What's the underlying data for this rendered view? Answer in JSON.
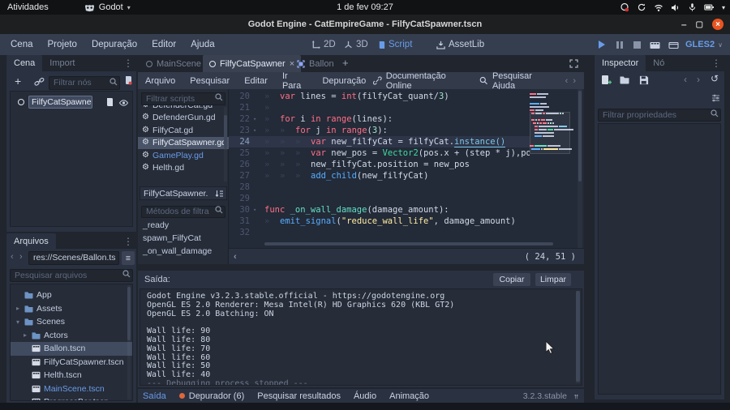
{
  "colors": {
    "accent": "#699ce8",
    "close_button": "#e95420",
    "keyword": "#ff7085",
    "type": "#3fdc9e",
    "function": "#57aeff",
    "string": "#ffeda1",
    "number": "#9fe8c8"
  },
  "desktop_bar": {
    "activities": "Atividades",
    "app_name": "Godot",
    "clock": "1 de fev 09:27"
  },
  "window": {
    "title": "Godot Engine - CatEmpireGame - FilfyCatSpawner.tscn"
  },
  "main_menu": {
    "items": [
      "Cena",
      "Projeto",
      "Depuração",
      "Editor",
      "Ajuda"
    ],
    "workspace_2d": "2D",
    "workspace_3d": "3D",
    "workspace_script": "Script",
    "workspace_assetlib": "AssetLib",
    "renderer": "GLES2"
  },
  "scene_dock": {
    "tab_scene": "Cena",
    "tab_import": "Import",
    "filter_placeholder": "Filtrar nós",
    "root_node": "FilfyCatSpawner"
  },
  "files_dock": {
    "title": "Arquivos",
    "path": "res://Scenes/Ballon.ts",
    "search_placeholder": "Pesquisar arquivos",
    "tree": [
      {
        "name": "App",
        "type": "folder",
        "depth": 1,
        "arrow": ""
      },
      {
        "name": "Assets",
        "type": "folder",
        "depth": 1,
        "arrow": "closed"
      },
      {
        "name": "Scenes",
        "type": "folder",
        "depth": 1,
        "arrow": "open"
      },
      {
        "name": "Actors",
        "type": "folder",
        "depth": 2,
        "arrow": "closed"
      },
      {
        "name": "Ballon.tscn",
        "type": "scene",
        "depth": 2,
        "selected": true
      },
      {
        "name": "FilfyCatSpawner.tscn",
        "type": "scene",
        "depth": 2
      },
      {
        "name": "Helth.tscn",
        "type": "scene",
        "depth": 2
      },
      {
        "name": "MainScene.tscn",
        "type": "scene",
        "depth": 2,
        "highlight": true
      },
      {
        "name": "ProgressBar.tscn",
        "type": "scene",
        "depth": 2
      }
    ]
  },
  "scene_tabs": {
    "tabs": [
      {
        "label": "MainScene",
        "active": false
      },
      {
        "label": "FilfyCatSpawner",
        "active": true,
        "closable": true
      },
      {
        "label": "Ballon",
        "active": false
      }
    ]
  },
  "script_editor": {
    "menus": [
      "Arquivo",
      "Pesquisar",
      "Editar",
      "Ir Para",
      "Depuração"
    ],
    "online_docs": "Documentação Online",
    "search_help": "Pesquisar Ajuda",
    "filter_scripts_placeholder": "Filtrar scripts",
    "scripts": [
      {
        "name": "DefenderCat.gd"
      },
      {
        "name": "DefenderGun.gd"
      },
      {
        "name": "FilfyCat.gd"
      },
      {
        "name": "FilfyCatSpawner.gd",
        "selected": true
      },
      {
        "name": "GamePlay.gd",
        "highlight": true
      },
      {
        "name": "Helth.gd"
      }
    ],
    "current_script": "FilfyCatSpawner.",
    "methods_filter_placeholder": "Métodos de filtra",
    "methods": [
      "_ready",
      "spawn_FilfyCat",
      "_on_wall_damage"
    ],
    "cursor_position": "( 24, 51 )",
    "code_lines": [
      {
        "n": 20,
        "indent": 1,
        "tokens": [
          {
            "t": "var ",
            "c": "kw"
          },
          {
            "t": "lines = ",
            "c": "tx"
          },
          {
            "t": "int",
            "c": "kw"
          },
          {
            "t": "(filfyCat_quant/",
            "c": "tx"
          },
          {
            "t": "3",
            "c": "num"
          },
          {
            "t": ")",
            "c": "tx"
          }
        ]
      },
      {
        "n": 21,
        "indent": 1,
        "tokens": []
      },
      {
        "n": 22,
        "indent": 1,
        "fold": true,
        "tokens": [
          {
            "t": "for ",
            "c": "kw"
          },
          {
            "t": "i ",
            "c": "tx"
          },
          {
            "t": "in ",
            "c": "kw"
          },
          {
            "t": "range",
            "c": "kw"
          },
          {
            "t": "(lines):",
            "c": "tx"
          }
        ]
      },
      {
        "n": 23,
        "indent": 2,
        "fold": true,
        "tokens": [
          {
            "t": "for ",
            "c": "kw"
          },
          {
            "t": "j ",
            "c": "tx"
          },
          {
            "t": "in ",
            "c": "kw"
          },
          {
            "t": "range",
            "c": "kw"
          },
          {
            "t": "(",
            "c": "tx"
          },
          {
            "t": "3",
            "c": "num"
          },
          {
            "t": "):",
            "c": "tx"
          }
        ]
      },
      {
        "n": 24,
        "indent": 3,
        "current": true,
        "tokens": [
          {
            "t": "var ",
            "c": "kw"
          },
          {
            "t": "new_filfyCat = filfyCat.",
            "c": "tx"
          },
          {
            "t": "instance()",
            "c": "mfn"
          }
        ]
      },
      {
        "n": 25,
        "indent": 3,
        "tokens": [
          {
            "t": "var ",
            "c": "kw"
          },
          {
            "t": "new_pos = ",
            "c": "tx"
          },
          {
            "t": "Vector2",
            "c": "ty"
          },
          {
            "t": "(pos.x + (step * j),pos.y + (i",
            "c": "tx"
          }
        ]
      },
      {
        "n": 26,
        "indent": 3,
        "tokens": [
          {
            "t": "new_filfyCat.position = new_pos",
            "c": "tx"
          }
        ]
      },
      {
        "n": 27,
        "indent": 3,
        "tokens": [
          {
            "t": "add_child",
            "c": "fn"
          },
          {
            "t": "(new_filfyCat)",
            "c": "tx"
          }
        ]
      },
      {
        "n": 28,
        "indent": 0,
        "tokens": []
      },
      {
        "n": 29,
        "indent": 0,
        "tokens": []
      },
      {
        "n": 30,
        "indent": 0,
        "fold": true,
        "tokens": [
          {
            "t": "func ",
            "c": "kw"
          },
          {
            "t": "_on_wall_damage",
            "c": "df"
          },
          {
            "t": "(damage_amount):",
            "c": "tx"
          }
        ]
      },
      {
        "n": 31,
        "indent": 1,
        "tokens": [
          {
            "t": "emit_signal",
            "c": "fn"
          },
          {
            "t": "(",
            "c": "tx"
          },
          {
            "t": "\"reduce_wall_life\"",
            "c": "st"
          },
          {
            "t": ", damage_amount)",
            "c": "tx"
          }
        ]
      },
      {
        "n": 32,
        "indent": 0,
        "tokens": []
      }
    ]
  },
  "output_panel": {
    "title": "Saída:",
    "copy_button": "Copiar",
    "clear_button": "Limpar",
    "lines": [
      {
        "text": "Godot Engine v3.2.3.stable.official - https://godotengine.org"
      },
      {
        "text": "OpenGL ES 2.0 Renderer: Mesa Intel(R) HD Graphics 620 (KBL GT2)"
      },
      {
        "text": "OpenGL ES 2.0 Batching: ON"
      },
      {
        "text": ""
      },
      {
        "text": "Wall life: 90"
      },
      {
        "text": "Wall life: 80"
      },
      {
        "text": "Wall life: 70"
      },
      {
        "text": "Wall life: 60"
      },
      {
        "text": "Wall life: 50"
      },
      {
        "text": "Wall life: 40"
      },
      {
        "text": "--- Debugging process stopped ---",
        "dim": true
      }
    ]
  },
  "bottom_bar": {
    "tabs": [
      {
        "label": "Saída",
        "active": true
      },
      {
        "label": "Depurador (6)",
        "dot": true
      },
      {
        "label": "Pesquisar resultados"
      },
      {
        "label": "Áudio"
      },
      {
        "label": "Animação"
      }
    ],
    "version": "3.2.3.stable"
  },
  "inspector_dock": {
    "tab_inspector": "Inspector",
    "tab_node": "Nó",
    "filter_placeholder": "Filtrar propriedades"
  }
}
